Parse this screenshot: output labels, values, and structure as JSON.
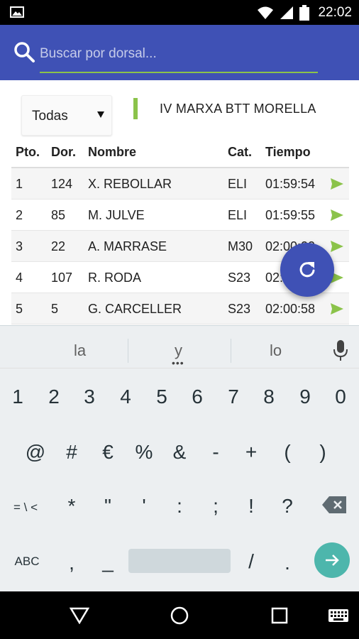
{
  "status_bar": {
    "time": "22:02",
    "icons": [
      "image-icon",
      "wifi-icon",
      "signal-icon",
      "battery-icon"
    ]
  },
  "search": {
    "placeholder": "Buscar por dorsal...",
    "value": ""
  },
  "filter": {
    "selected": "Todas"
  },
  "event": {
    "title": "IV MARXA BTT MORELLA"
  },
  "table": {
    "headers": [
      "Pto.",
      "Dor.",
      "Nombre",
      "Cat.",
      "Tiempo"
    ],
    "rows": [
      {
        "pos": "1",
        "dorsal": "124",
        "name": "X. REBOLLAR",
        "cat": "ELI",
        "time": "01:59:54"
      },
      {
        "pos": "2",
        "dorsal": "85",
        "name": "M. JULVE",
        "cat": "ELI",
        "time": "01:59:55"
      },
      {
        "pos": "3",
        "dorsal": "22",
        "name": "A. MARRASE",
        "cat": "M30",
        "time": "02:00:00"
      },
      {
        "pos": "4",
        "dorsal": "107",
        "name": "R. RODA",
        "cat": "S23",
        "time": "02:00:10"
      },
      {
        "pos": "5",
        "dorsal": "5",
        "name": "G. CARCELLER",
        "cat": "S23",
        "time": "02:00:58"
      }
    ]
  },
  "keyboard": {
    "suggestions": [
      "la",
      "y",
      "lo"
    ],
    "row1": [
      "1",
      "2",
      "3",
      "4",
      "5",
      "6",
      "7",
      "8",
      "9",
      "0"
    ],
    "row2": [
      "@",
      "#",
      "€",
      "%",
      "&",
      "-",
      "+",
      "(",
      ")"
    ],
    "row3": [
      "= \\ <",
      "*",
      "\"",
      "'",
      ":",
      ";",
      "!",
      "?"
    ],
    "row4": [
      "ABC",
      ",",
      "_",
      "/",
      "."
    ]
  },
  "colors": {
    "primary": "#3f51b5",
    "accent": "#8bc34a",
    "enter_key": "#4db6ac"
  }
}
